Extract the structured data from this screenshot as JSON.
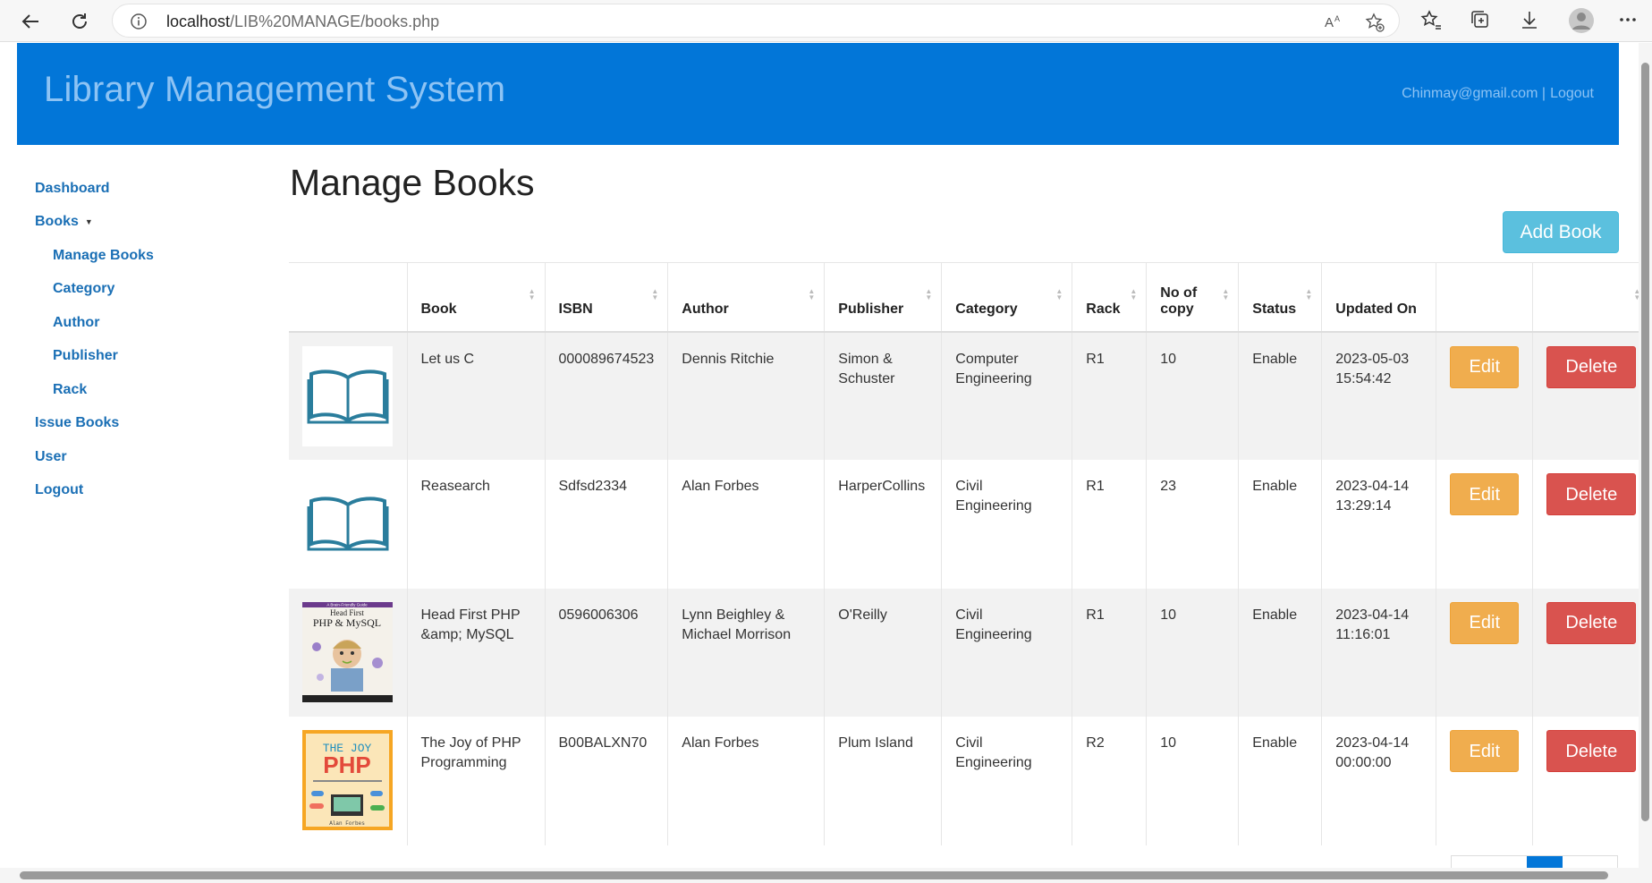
{
  "browser": {
    "url_host": "localhost",
    "url_path": "/LIB%20MANAGE/books.php"
  },
  "header": {
    "title": "Library Management System",
    "user": "Chinmay@gmail.com |",
    "logout": "Logout"
  },
  "sidebar": {
    "items": [
      {
        "label": "Dashboard"
      },
      {
        "label": "Books"
      },
      {
        "label": "Manage Books"
      },
      {
        "label": "Category"
      },
      {
        "label": "Author"
      },
      {
        "label": "Publisher"
      },
      {
        "label": "Rack"
      },
      {
        "label": "Issue Books"
      },
      {
        "label": "User"
      },
      {
        "label": "Logout"
      }
    ]
  },
  "main": {
    "title": "Manage Books",
    "add_button": "Add Book",
    "columns": [
      "",
      "Book",
      "ISBN",
      "Author",
      "Publisher",
      "Category",
      "Rack",
      "No of copy",
      "Status",
      "Updated On",
      "",
      ""
    ],
    "edit_label": "Edit",
    "delete_label": "Delete",
    "rows": [
      {
        "book": "Let us C",
        "isbn": "000089674523",
        "author": "Dennis Ritchie",
        "publisher": "Simon & Schuster",
        "category": "Computer Engineering",
        "rack": "R1",
        "copies": "10",
        "status": "Enable",
        "updated_date": "2023-05-03",
        "updated_time": "15:54:42",
        "cover": "open-book-icon"
      },
      {
        "book": "Reasearch",
        "isbn": "Sdfsd2334",
        "author": "Alan Forbes",
        "publisher": "HarperCollins",
        "category": "Civil Engineering",
        "rack": "R1",
        "copies": "23",
        "status": "Enable",
        "updated_date": "2023-04-14",
        "updated_time": "13:29:14",
        "cover": "open-book-icon"
      },
      {
        "book": "Head First PHP &amp; MySQL",
        "isbn": "0596006306",
        "author": "Lynn Beighley & Michael Morrison",
        "publisher": "O'Reilly",
        "category": "Civil Engineering",
        "rack": "R1",
        "copies": "10",
        "status": "Enable",
        "updated_date": "2023-04-14",
        "updated_time": "11:16:01",
        "cover": "head-first-php-cover"
      },
      {
        "book": "The Joy of PHP Programming",
        "isbn": "B00BALXN70",
        "author": "Alan Forbes",
        "publisher": "Plum Island",
        "category": "Civil Engineering",
        "rack": "R2",
        "copies": "10",
        "status": "Enable",
        "updated_date": "2023-04-14",
        "updated_time": "00:00:00",
        "cover": "joy-of-php-cover"
      }
    ]
  },
  "covers": {
    "head_first": {
      "tag": "A Brain-Friendly Guide",
      "line1": "Head First",
      "line2": "PHP & MySQL"
    },
    "joy": {
      "line1": "THE JOY",
      "line2": "PHP",
      "author": "Alan Forbes"
    }
  },
  "colors": {
    "header_bg": "#0276d8",
    "link": "#1a6fb5",
    "add_button": "#5bc0de",
    "edit_button": "#f0ad4e",
    "delete_button": "#d9534f"
  }
}
